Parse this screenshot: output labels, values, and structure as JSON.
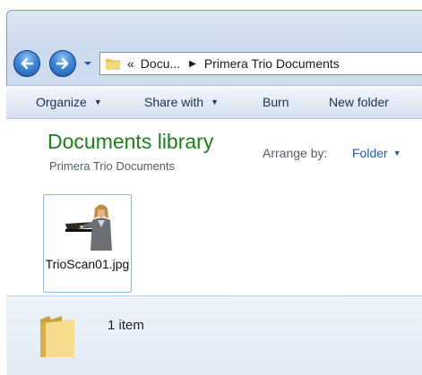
{
  "address_bar": {
    "overflow": "«",
    "crumbs": [
      "Docu...",
      "Primera Trio Documents"
    ]
  },
  "toolbar": {
    "organize": "Organize",
    "share_with": "Share with",
    "burn": "Burn",
    "new_folder": "New folder"
  },
  "library": {
    "title": "Documents library",
    "subtitle": "Primera Trio Documents",
    "arrange_label": "Arrange by:",
    "arrange_value": "Folder"
  },
  "files": [
    {
      "name": "TrioScan01.jpg",
      "icon": "image-thumbnail-icon"
    }
  ],
  "details": {
    "count": "1 item",
    "icon": "folder-icon"
  },
  "colors": {
    "library_title": "#1e7e1e",
    "link_blue": "#1f5fbf",
    "nav_button": "#3f86d6"
  }
}
